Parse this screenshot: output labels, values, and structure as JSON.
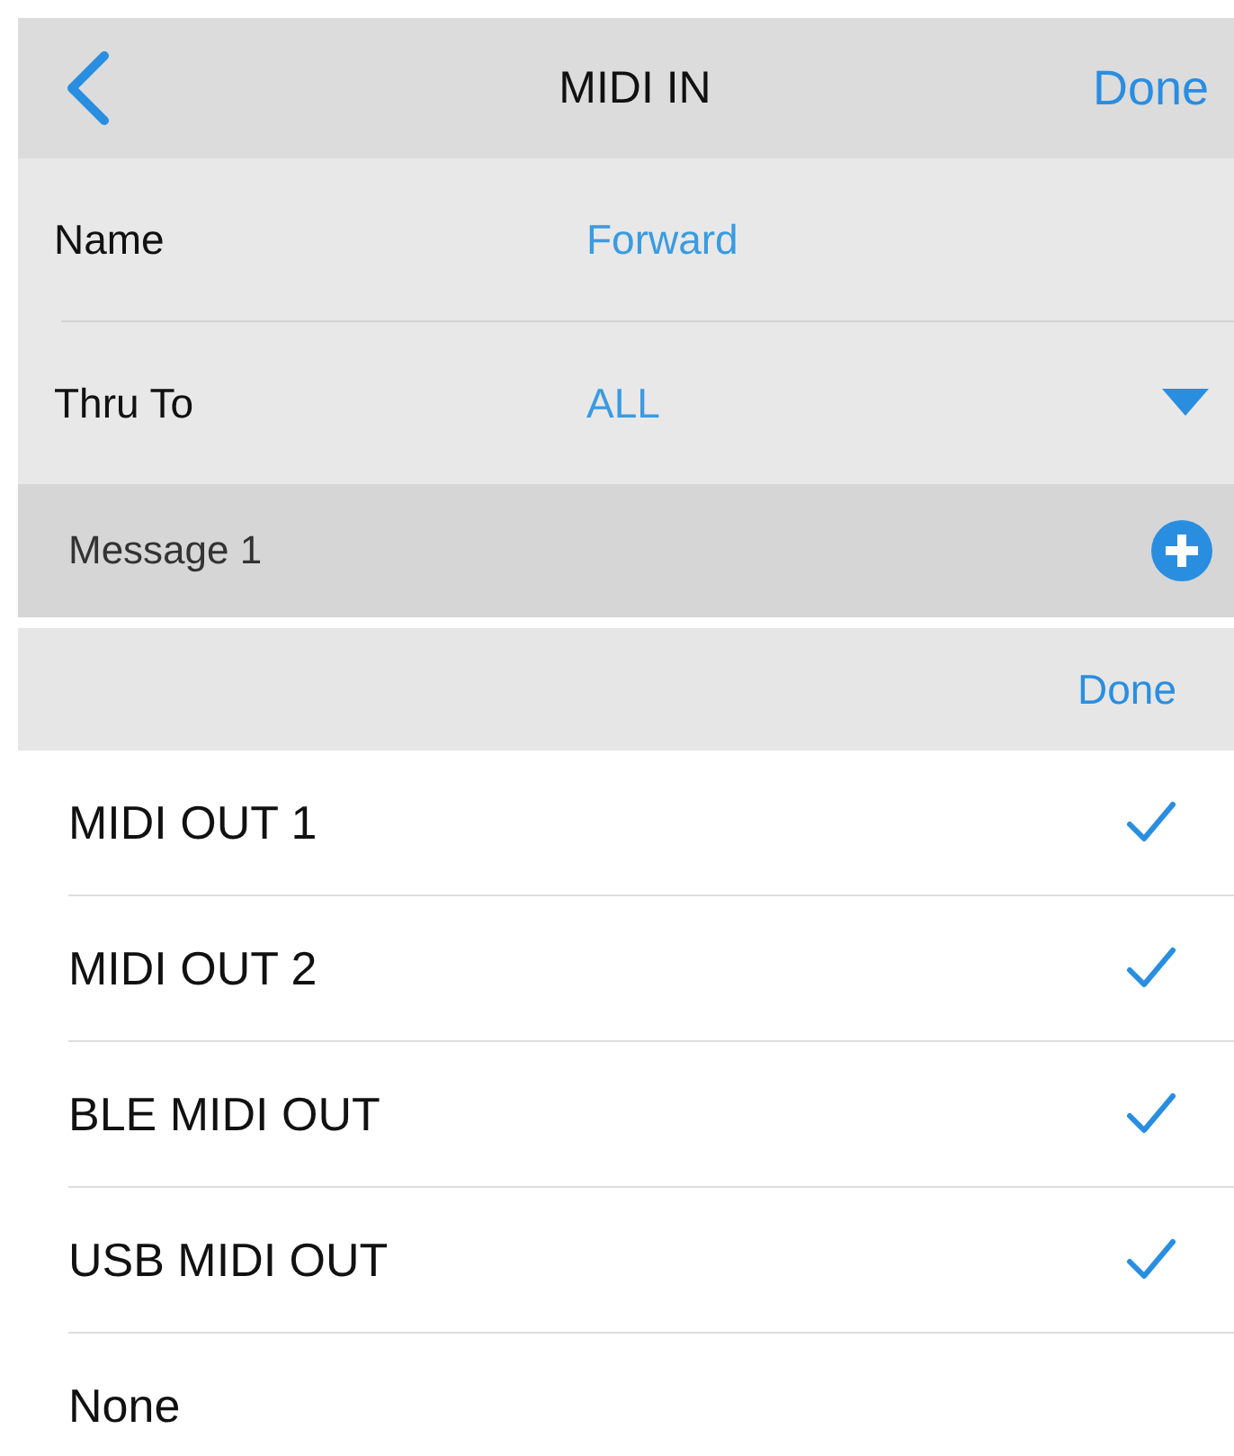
{
  "nav_bar": {
    "title": "MIDI IN",
    "done": "Done"
  },
  "fields": [
    {
      "kind": "text",
      "label": "Name",
      "value": "Forward"
    },
    {
      "kind": "dropdown",
      "label": "Thru To",
      "value": "ALL"
    }
  ],
  "message_header": {
    "label": "Message 1"
  },
  "picker": {
    "done": "Done",
    "options": [
      {
        "label": "MIDI OUT 1",
        "checked": true
      },
      {
        "label": "MIDI OUT 2",
        "checked": true
      },
      {
        "label": "BLE MIDI OUT",
        "checked": true
      },
      {
        "label": "USB MIDI OUT",
        "checked": true
      },
      {
        "label": "None",
        "checked": false
      }
    ]
  }
}
